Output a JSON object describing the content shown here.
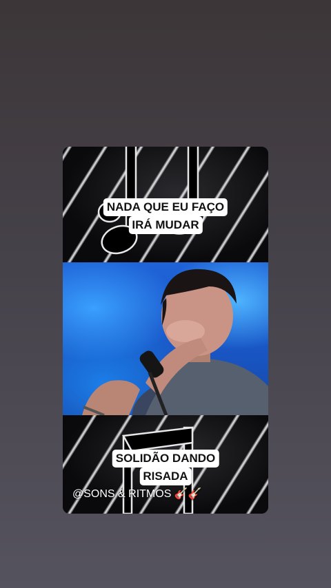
{
  "story": {
    "caption_top": {
      "line1": "NADA QUE EU FAÇO",
      "line2": "IRÁ MUDAR"
    },
    "caption_bottom": {
      "line1": "SOLIDÃO DANDO",
      "line2": "RISADA"
    },
    "handle": "@SONS & RITMOS 🎸🎸",
    "icons": {
      "top_decor": "music-note-icon",
      "bottom_decor": "music-note-icon"
    },
    "colors": {
      "background": "#46424a",
      "caption_bg": "#ffffff",
      "caption_text": "#111111",
      "video_blue": "#1f63d8"
    }
  }
}
